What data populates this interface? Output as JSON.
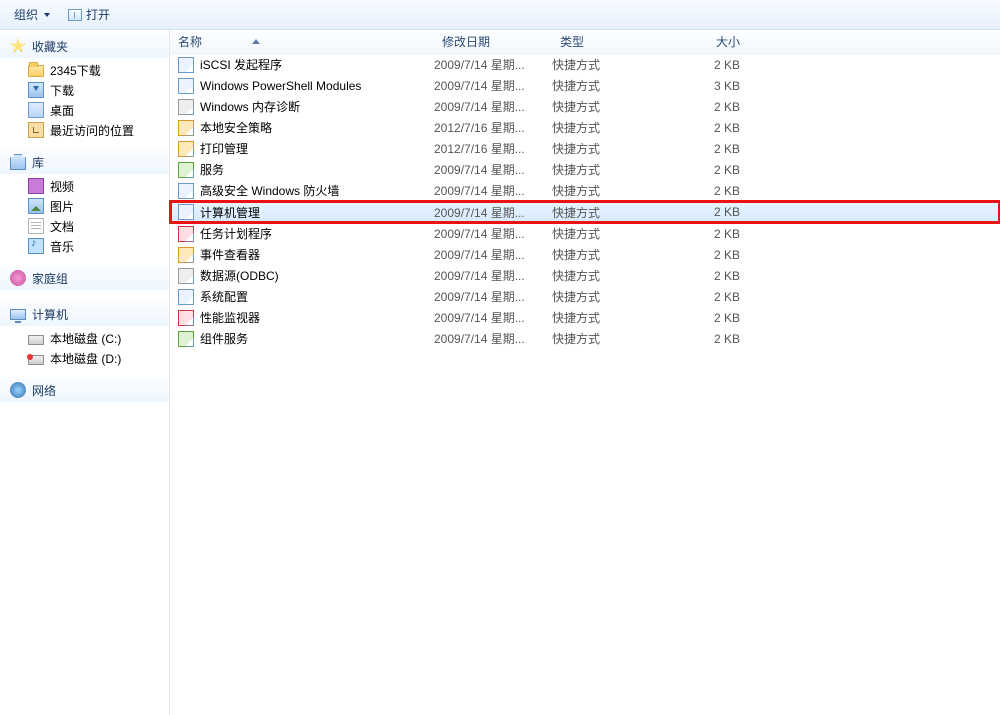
{
  "toolbar": {
    "organize": "组织",
    "open": "打开"
  },
  "sidebar": {
    "favorites": {
      "label": "收藏夹",
      "items": [
        {
          "label": "2345下载"
        },
        {
          "label": "下载"
        },
        {
          "label": "桌面"
        },
        {
          "label": "最近访问的位置"
        }
      ]
    },
    "libraries": {
      "label": "库",
      "items": [
        {
          "label": "视频"
        },
        {
          "label": "图片"
        },
        {
          "label": "文档"
        },
        {
          "label": "音乐"
        }
      ]
    },
    "homegroup": {
      "label": "家庭组"
    },
    "computer": {
      "label": "计算机",
      "items": [
        {
          "label": "本地磁盘 (C:)"
        },
        {
          "label": "本地磁盘 (D:)"
        }
      ]
    },
    "network": {
      "label": "网络"
    }
  },
  "columns": {
    "name": "名称",
    "date": "修改日期",
    "type": "类型",
    "size": "大小"
  },
  "type_shortcut": "快捷方式",
  "files": [
    {
      "name": "iSCSI 发起程序",
      "date": "2009/7/14 星期...",
      "size": "2 KB",
      "icon": "fi"
    },
    {
      "name": "Windows PowerShell Modules",
      "date": "2009/7/14 星期...",
      "size": "3 KB",
      "icon": "fi"
    },
    {
      "name": "Windows 内存诊断",
      "date": "2009/7/14 星期...",
      "size": "2 KB",
      "icon": "fi gray"
    },
    {
      "name": "本地安全策略",
      "date": "2012/7/16 星期...",
      "size": "2 KB",
      "icon": "fi orange"
    },
    {
      "name": "打印管理",
      "date": "2012/7/16 星期...",
      "size": "2 KB",
      "icon": "fi orange"
    },
    {
      "name": "服务",
      "date": "2009/7/14 星期...",
      "size": "2 KB",
      "icon": "fi green"
    },
    {
      "name": "高级安全 Windows 防火墙",
      "date": "2009/7/14 星期...",
      "size": "2 KB",
      "icon": "fi"
    },
    {
      "name": "计算机管理",
      "date": "2009/7/14 星期...",
      "size": "2 KB",
      "icon": "fi",
      "selected": true,
      "highlight": true
    },
    {
      "name": "任务计划程序",
      "date": "2009/7/14 星期...",
      "size": "2 KB",
      "icon": "fi red"
    },
    {
      "name": "事件查看器",
      "date": "2009/7/14 星期...",
      "size": "2 KB",
      "icon": "fi orange"
    },
    {
      "name": "数据源(ODBC)",
      "date": "2009/7/14 星期...",
      "size": "2 KB",
      "icon": "fi gray"
    },
    {
      "name": "系统配置",
      "date": "2009/7/14 星期...",
      "size": "2 KB",
      "icon": "fi"
    },
    {
      "name": "性能监视器",
      "date": "2009/7/14 星期...",
      "size": "2 KB",
      "icon": "fi red"
    },
    {
      "name": "组件服务",
      "date": "2009/7/14 星期...",
      "size": "2 KB",
      "icon": "fi green"
    }
  ]
}
